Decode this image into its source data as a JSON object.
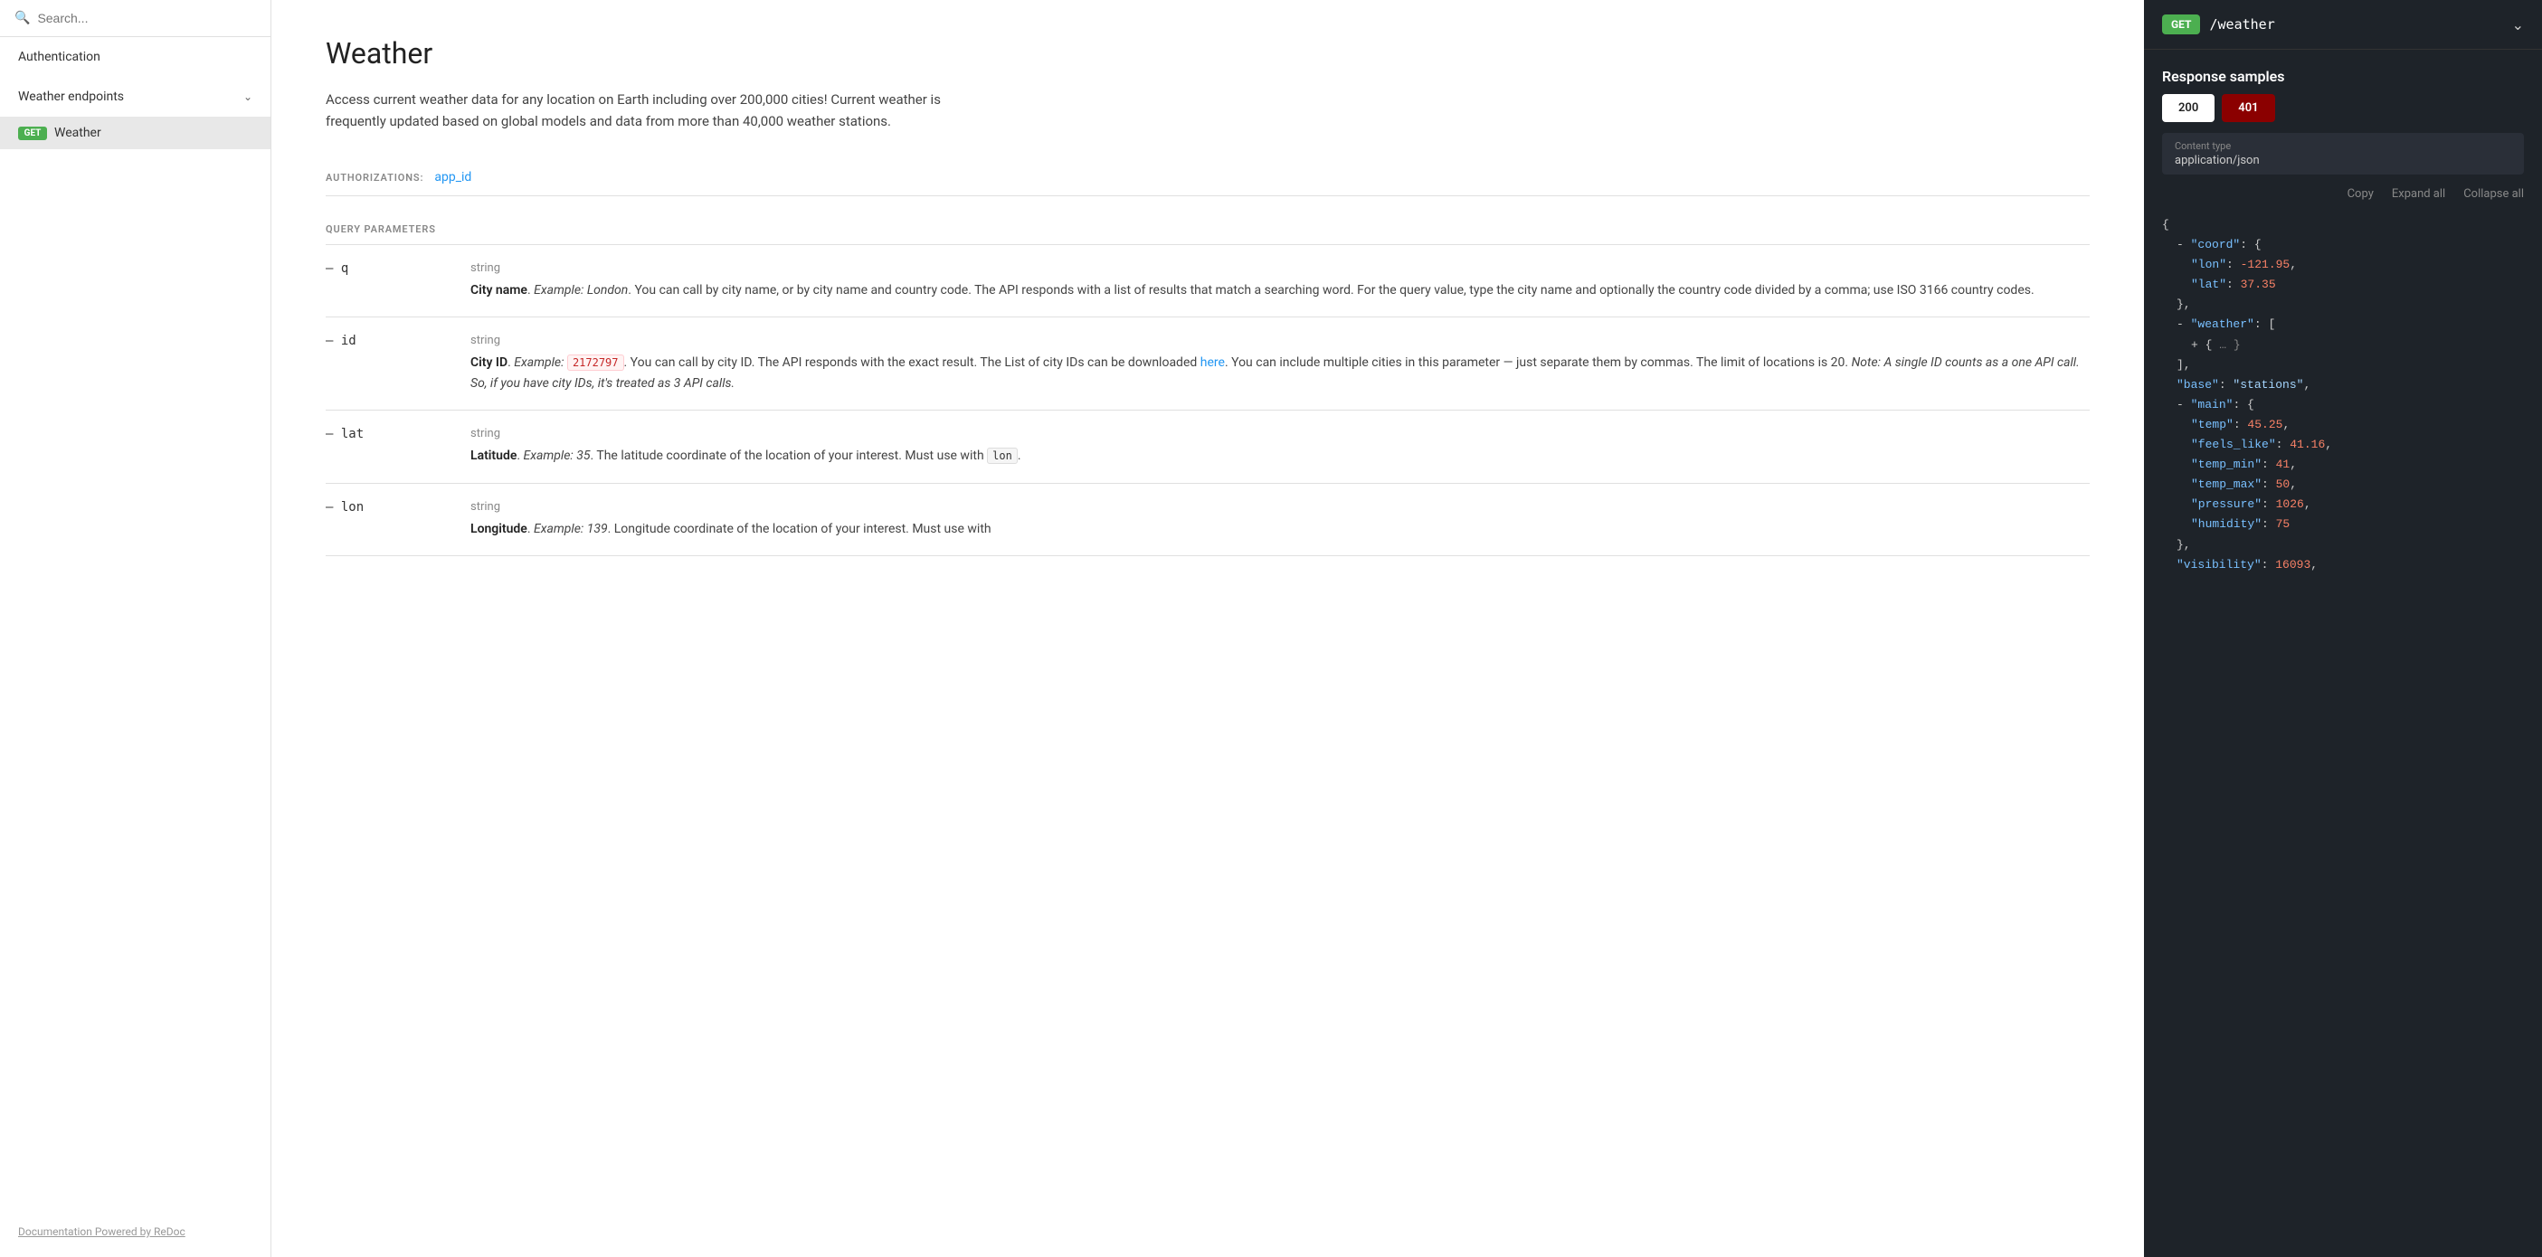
{
  "sidebar": {
    "search_placeholder": "Search...",
    "nav_items": [
      {
        "id": "authentication",
        "label": "Authentication",
        "type": "section"
      },
      {
        "id": "weather-endpoints",
        "label": "Weather endpoints",
        "type": "collapsible",
        "expanded": true
      },
      {
        "id": "weather",
        "label": "Weather",
        "type": "endpoint",
        "method": "GET",
        "active": true
      }
    ],
    "powered_by": "Documentation Powered by ReDoc"
  },
  "main": {
    "title": "Weather",
    "description": "Access current weather data for any location on Earth including over 200,000 cities! Current weather is frequently updated based on global models and data from more than 40,000 weather stations.",
    "authorizations_label": "AUTHORIZATIONS:",
    "auth_link": "app_id",
    "query_params_label": "QUERY PARAMETERS",
    "params": [
      {
        "name": "q",
        "type": "string",
        "desc_parts": [
          {
            "type": "bold",
            "text": "City name"
          },
          {
            "type": "text",
            "text": ". "
          },
          {
            "type": "italic",
            "text": "Example: London"
          },
          {
            "type": "text",
            "text": ". You can call by city name, or by city name and country code. The API responds with a list of results that match a searching word. For the query value, type the city name and optionally the country code divided by a comma; use ISO 3166 country codes."
          }
        ]
      },
      {
        "name": "id",
        "type": "string",
        "desc_parts": [
          {
            "type": "bold",
            "text": "City ID"
          },
          {
            "type": "text",
            "text": ". "
          },
          {
            "type": "italic",
            "text": "Example: "
          },
          {
            "type": "code-red",
            "text": "2172797"
          },
          {
            "type": "text",
            "text": ". You can call by city ID. The API responds with the exact result. The List of city IDs can be downloaded "
          },
          {
            "type": "link",
            "text": "here"
          },
          {
            "type": "text",
            "text": ". You can include multiple cities in this parameter — just separate them by commas. The limit of locations is 20. "
          },
          {
            "type": "italic",
            "text": "Note: A single ID counts as a one API call. So, if you have city IDs, it's treated as 3 API calls."
          }
        ]
      },
      {
        "name": "lat",
        "type": "string",
        "desc_parts": [
          {
            "type": "bold",
            "text": "Latitude"
          },
          {
            "type": "text",
            "text": ". "
          },
          {
            "type": "italic",
            "text": "Example: 35"
          },
          {
            "type": "text",
            "text": ". The latitude coordinate of the location of your interest. Must use with "
          },
          {
            "type": "code-gray",
            "text": "lon"
          },
          {
            "type": "text",
            "text": "."
          }
        ]
      },
      {
        "name": "lon",
        "type": "string",
        "desc_parts": [
          {
            "type": "bold",
            "text": "Longitude"
          },
          {
            "type": "text",
            "text": ". "
          },
          {
            "type": "italic",
            "text": "Example: 139"
          },
          {
            "type": "text",
            "text": ". Longitude coordinate of the location of your interest. Must use with "
          }
        ]
      }
    ]
  },
  "right_panel": {
    "method": "GET",
    "path": "/weather",
    "response_samples_label": "Response samples",
    "tabs": [
      {
        "code": "200",
        "active": true
      },
      {
        "code": "401",
        "active": false
      }
    ],
    "content_type_label": "Content type",
    "content_type_value": "application/json",
    "actions": [
      "Copy",
      "Expand all",
      "Collapse all"
    ],
    "json": {
      "coord": {
        "lon": -121.95,
        "lat": 37.35
      },
      "weather": "array",
      "base": "stations",
      "main": {
        "temp": 45.25,
        "feels_like": 41.16,
        "temp_min": 41,
        "temp_max": 50,
        "pressure": 1026,
        "humidity": 75
      },
      "visibility": 16093
    }
  }
}
